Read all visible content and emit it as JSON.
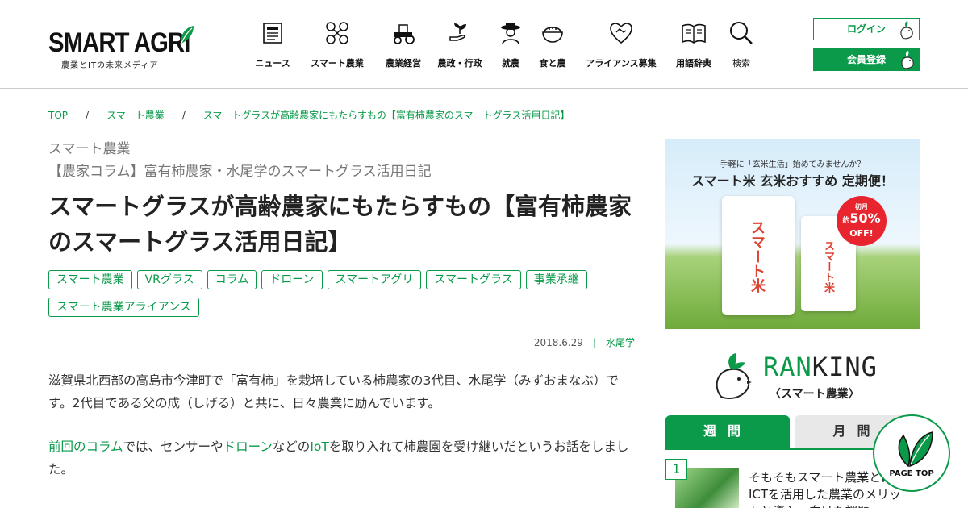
{
  "header": {
    "logo_main": "SMART AGRI",
    "logo_sub": "農業とITの未来メディア",
    "nav": [
      {
        "label": "ニュース",
        "icon": "newspaper-icon"
      },
      {
        "label": "スマート農業",
        "icon": "drone-icon"
      },
      {
        "label": "農業経営",
        "icon": "tractor-icon"
      },
      {
        "label": "農政・行政",
        "icon": "sprout-hand-icon"
      },
      {
        "label": "就農",
        "icon": "farmer-icon"
      },
      {
        "label": "食と農",
        "icon": "rice-bowl-icon"
      },
      {
        "label": "アライアンス募集",
        "icon": "heart-handshake-icon"
      },
      {
        "label": "用語辞典",
        "icon": "book-icon"
      },
      {
        "label": "検索",
        "icon": "search-icon"
      }
    ],
    "login_label": "ログイン",
    "member_label": "会員登録"
  },
  "breadcrumb": [
    "TOP",
    "スマート農業",
    "スマートグラスが高齢農家にもたらすもの【富有柿農家のスマートグラス活用日記】"
  ],
  "article": {
    "category": "スマート農業",
    "series": "【農家コラム】富有柿農家・水尾学のスマートグラス活用日記",
    "title": "スマートグラスが高齢農家にもたらすもの【富有柿農家のスマートグラス活用日記】",
    "tags": [
      "スマート農業",
      "VRグラス",
      "コラム",
      "ドローン",
      "スマートアグリ",
      "スマートグラス",
      "事業承継",
      "スマート農業アライアンス"
    ],
    "date": "2018.6.29",
    "author": "水尾学",
    "para1": "滋賀県北西部の高島市今津町で「富有柿」を栽培している柿農家の3代目、水尾学（みずおまなぶ）です。2代目である父の成（しげる）と共に、日々農業に励んでいます。",
    "para2": {
      "link1": "前回のコラム",
      "t1": "では、センサーや",
      "link2": "ドローン",
      "t2": "などの",
      "link3": "IoT",
      "t3": "を取り入れて柿農園を受け継いだというお話をしました。"
    }
  },
  "sidebar": {
    "ad": {
      "line1": "手軽に「玄米生活」始めてみませんか？",
      "line2": "スマート米 玄米おすすめ 定期便！",
      "bag_label": "スマート米",
      "badge_small": "初月",
      "badge_pre": "約",
      "badge_pct": "50%",
      "badge_off": "OFF!"
    },
    "ranking": {
      "title_green": "RAN",
      "title_dark": "KING",
      "subtitle": "〈スマート農業〉",
      "tab_week": "週間",
      "tab_month": "月間",
      "items": [
        {
          "rank": "1",
          "title": "そもそもスマート農業とは？ ICTを活用した農業のメリットと導入・向けた課題"
        }
      ]
    },
    "pagetop_label": "PAGE TOP"
  },
  "colors": {
    "brand_green": "#0a9a4a"
  }
}
